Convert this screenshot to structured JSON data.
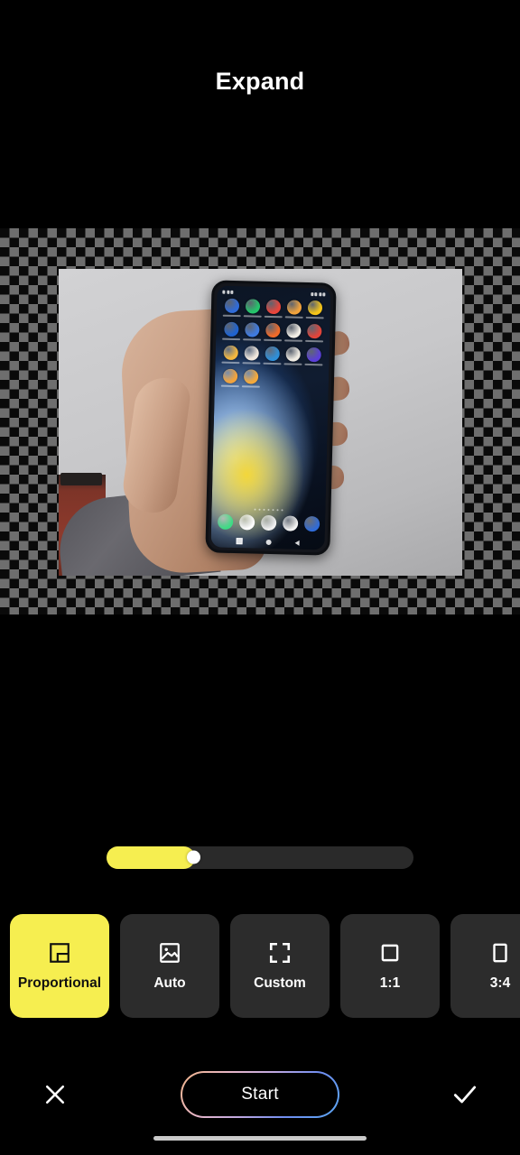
{
  "header": {
    "title": "Expand"
  },
  "canvas": {
    "name": "expand-preview-canvas",
    "checkerboard_colors": [
      "#0a0a0a",
      "#6e6e6e"
    ],
    "photo_description": "Hand holding a smartphone displaying an app grid home screen with blue and yellow wallpaper"
  },
  "phone_preview": {
    "app_icon_colors": [
      "#2f6bd8",
      "#25c46b",
      "#e8453c",
      "#f2a33c",
      "#f5c518",
      "#1f63cf",
      "#3f7be0",
      "#ef6a2a",
      "#f2eee6",
      "#e0443a",
      "#f3b73f",
      "#f0e7dd",
      "#2f8fd8",
      "#f0ece3",
      "#5b3fd8",
      "#f2a33c",
      "#f4a93b"
    ],
    "dock_icon_colors": [
      "#3ddc84",
      "#ffffff",
      "#f1f1f1",
      "#f3f3f3",
      "#2f6bd8"
    ],
    "page_dot_count": 7
  },
  "slider": {
    "name": "expand-amount-slider",
    "value_percent": 28.8,
    "fill_color": "#f6ee50",
    "track_color": "#2a2a2a",
    "thumb_color": "#ffffff"
  },
  "ratio_chips": {
    "selected_index": 0,
    "selected_color": "#f6ee50",
    "chip_color": "#2c2c2c",
    "items": [
      {
        "label": "Proportional",
        "icon": "proportional-icon"
      },
      {
        "label": "Auto",
        "icon": "image-icon"
      },
      {
        "label": "Custom",
        "icon": "crop-corners-icon"
      },
      {
        "label": "1:1",
        "icon": "square-icon"
      },
      {
        "label": "3:4",
        "icon": "portrait-rect-icon"
      }
    ]
  },
  "actions": {
    "cancel_icon": "close-icon",
    "start_label": "Start",
    "confirm_icon": "check-icon",
    "start_gradient": [
      "#f0b487",
      "#e7b6c8",
      "#c0a8e0",
      "#6f8df0",
      "#5aa7f2"
    ]
  },
  "system": {
    "home_indicator_color": "#c9c9c9"
  }
}
